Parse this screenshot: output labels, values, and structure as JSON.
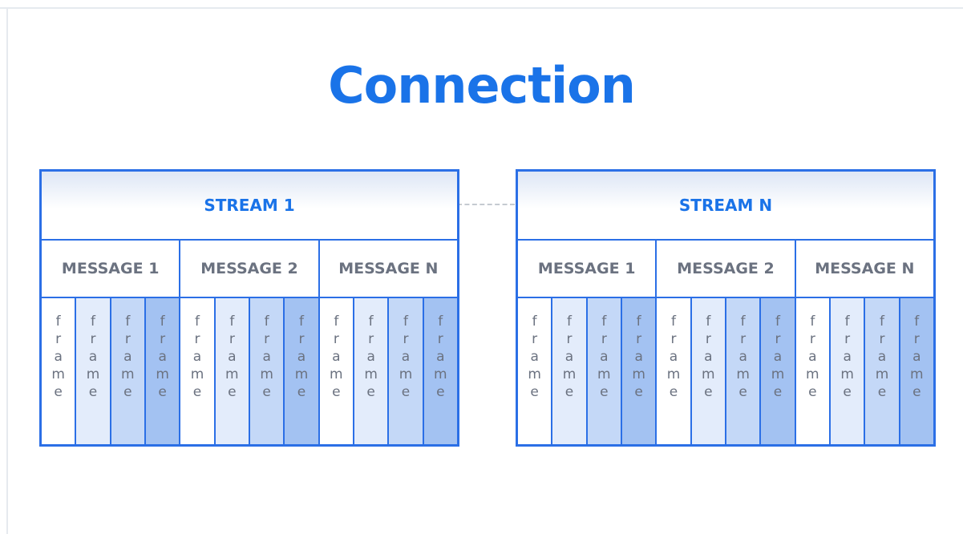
{
  "title": "Connection",
  "streams": [
    {
      "label": "STREAM 1",
      "messages": [
        {
          "label": "MESSAGE 1",
          "frames": [
            "frame",
            "frame",
            "frame",
            "frame"
          ]
        },
        {
          "label": "MESSAGE 2",
          "frames": [
            "frame",
            "frame",
            "frame",
            "frame"
          ]
        },
        {
          "label": "MESSAGE N",
          "frames": [
            "frame",
            "frame",
            "frame",
            "frame"
          ]
        }
      ]
    },
    {
      "label": "STREAM N",
      "messages": [
        {
          "label": "MESSAGE 1",
          "frames": [
            "frame",
            "frame",
            "frame",
            "frame"
          ]
        },
        {
          "label": "MESSAGE 2",
          "frames": [
            "frame",
            "frame",
            "frame",
            "frame"
          ]
        },
        {
          "label": "MESSAGE N",
          "frames": [
            "frame",
            "frame",
            "frame",
            "frame"
          ]
        }
      ]
    }
  ],
  "colors": {
    "accent": "#1a73e8",
    "border": "#2b6fe6",
    "label_gray": "#6b7280",
    "frame_shades": [
      "#ffffff",
      "#e3ecfb",
      "#c4d8f7",
      "#a3c2f2"
    ],
    "connector": "#c5cad1"
  }
}
